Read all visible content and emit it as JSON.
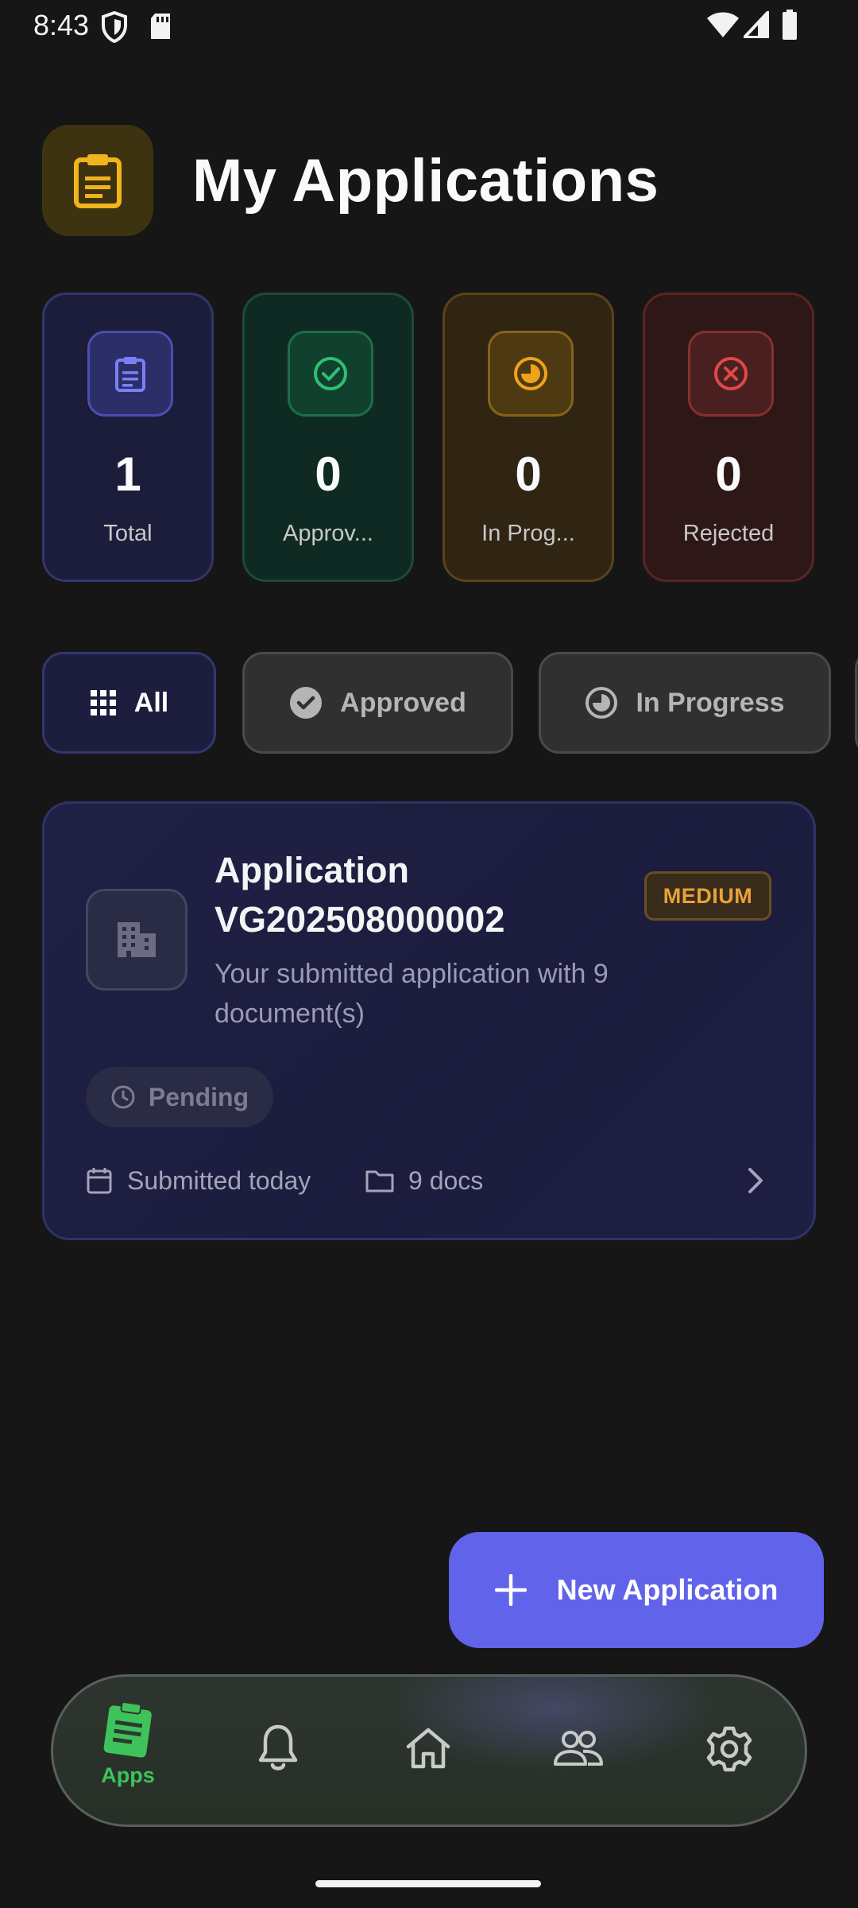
{
  "status_bar": {
    "time": "8:43"
  },
  "header": {
    "title": "My Applications",
    "icon": "clipboard-icon"
  },
  "stats": [
    {
      "value": "1",
      "label": "Total",
      "icon": "clipboard-icon",
      "color": "#6b6ff0"
    },
    {
      "value": "0",
      "label": "Approv...",
      "icon": "check-circle-icon",
      "color": "#2fbf71"
    },
    {
      "value": "0",
      "label": "In Prog...",
      "icon": "progress-icon",
      "color": "#f0a21c"
    },
    {
      "value": "0",
      "label": "Rejected",
      "icon": "x-circle-icon",
      "color": "#e04848"
    }
  ],
  "filters": [
    {
      "label": "All",
      "icon": "grid-icon",
      "selected": true
    },
    {
      "label": "Approved",
      "icon": "check-circle-icon",
      "selected": false
    },
    {
      "label": "In Progress",
      "icon": "progress-icon",
      "selected": false
    }
  ],
  "application": {
    "title": "Application VG202508000002",
    "priority": "MEDIUM",
    "description": "Your submitted application with 9 document(s)",
    "status": "Pending",
    "submitted": "Submitted today",
    "docs": "9 docs"
  },
  "fab": {
    "label": "New Application"
  },
  "bottom_nav": [
    {
      "label": "Apps",
      "icon": "clipboard-icon",
      "active": true
    },
    {
      "label": "",
      "icon": "bell-icon",
      "active": false
    },
    {
      "label": "",
      "icon": "home-icon",
      "active": false
    },
    {
      "label": "",
      "icon": "people-icon",
      "active": false
    },
    {
      "label": "",
      "icon": "gear-icon",
      "active": false
    }
  ],
  "colors": {
    "accent": "#6163ea",
    "background": "#161616",
    "nav_active": "#3ec25b",
    "header_icon": "#f0b41c"
  }
}
